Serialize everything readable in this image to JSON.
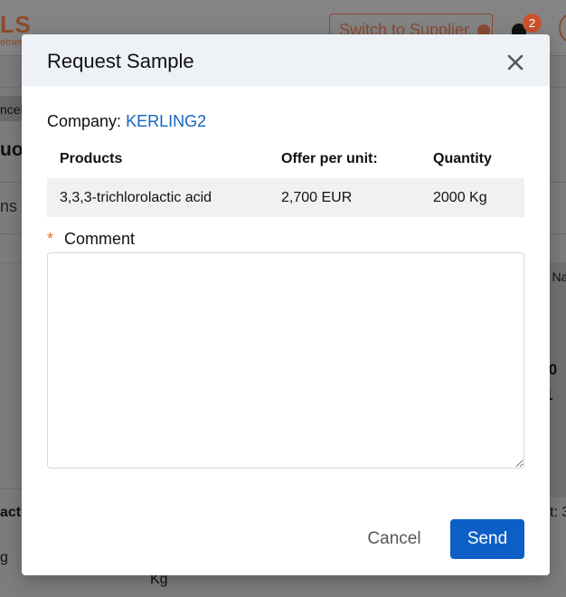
{
  "background": {
    "logo": "LS",
    "logo_sub": "emer",
    "switch_button_label": "Switch to Supplier",
    "notifications_count": "2",
    "cancel_chip_label": "ncel",
    "heading_fragment": "uot",
    "items_fragment": "ns",
    "right_text_1": "r Na",
    "right_text_2": ".0",
    "right_text_3": "1",
    "bottom_left_1": "act",
    "bottom_left_2": "g",
    "bottom_middle": "Kg",
    "bottom_right": "t: 3"
  },
  "modal": {
    "title": "Request Sample",
    "company_label": "Company:",
    "company_value": "KERLING2",
    "table": {
      "headers": [
        "Products",
        "Offer per unit:",
        "Quantity"
      ],
      "rows": [
        [
          "3,3,3-trichlorolactic acid",
          "2,700 EUR",
          "2000 Kg"
        ]
      ]
    },
    "comment": {
      "required_marker": "*",
      "label": "Comment",
      "value": "",
      "placeholder": ""
    },
    "buttons": {
      "cancel": "Cancel",
      "send": "Send"
    }
  },
  "colors": {
    "link": "#1565c0",
    "required": "#ef6a2b",
    "primary": "#0d5fc7",
    "header_bg": "#eef2f6",
    "row_bg": "#f1f1f1",
    "overlay": "#7d7d7d"
  },
  "icons": {
    "close": "close-icon",
    "bell": "bell-icon",
    "supplier": "supplier-switch-icon"
  }
}
